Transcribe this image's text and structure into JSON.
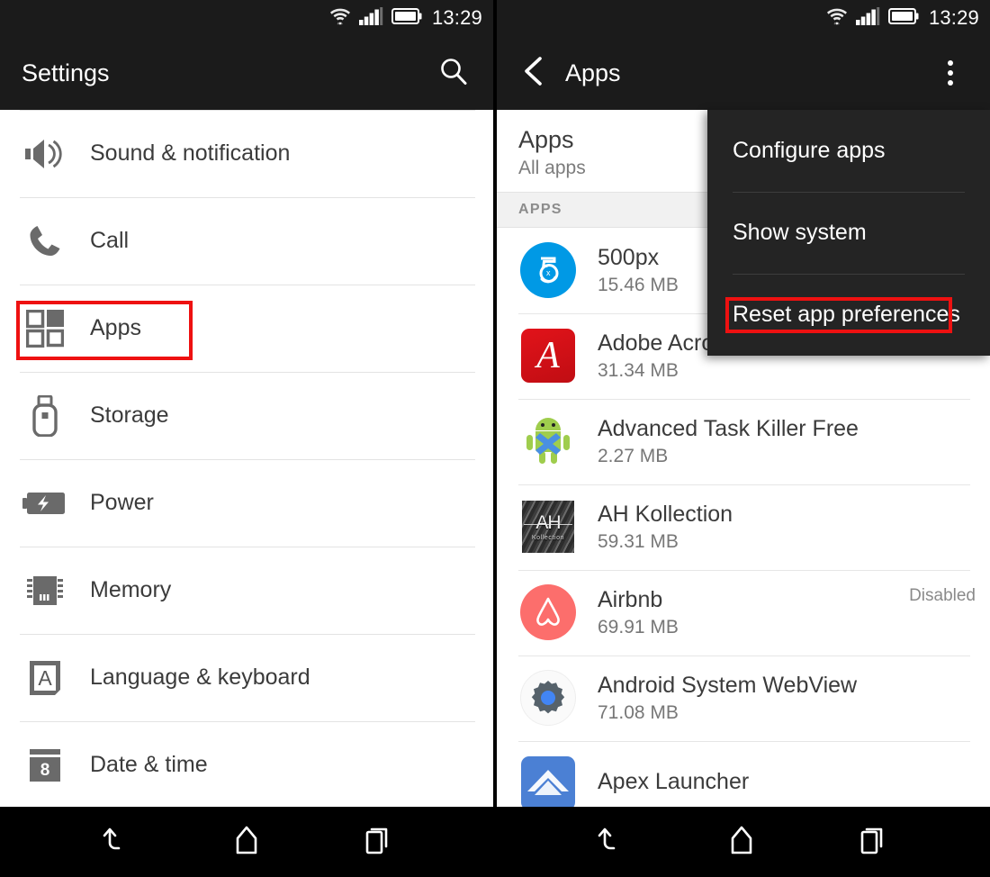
{
  "statusbar": {
    "time": "13:29",
    "icons": [
      "wifi-icon",
      "signal-icon",
      "battery-icon"
    ]
  },
  "left_screen": {
    "title": "Settings",
    "search_icon": "search-icon",
    "items": [
      {
        "label": "Sound & notification",
        "icon": "speaker-icon"
      },
      {
        "label": "Call",
        "icon": "phone-icon"
      },
      {
        "label": "Apps",
        "icon": "apps-grid-icon",
        "highlighted": true
      },
      {
        "label": "Storage",
        "icon": "usb-drive-icon"
      },
      {
        "label": "Power",
        "icon": "battery-bolt-icon"
      },
      {
        "label": "Memory",
        "icon": "memory-chip-icon"
      },
      {
        "label": "Language & keyboard",
        "icon": "letter-a-icon"
      },
      {
        "label": "Date & time",
        "icon": "calendar-icon"
      }
    ]
  },
  "right_screen": {
    "back_icon": "chevron-left-icon",
    "title": "Apps",
    "overflow_icon": "overflow-menu-icon",
    "header": {
      "title": "Apps",
      "subtitle": "All apps"
    },
    "section_label": "APPS",
    "apps": [
      {
        "name": "500px",
        "size": "15.46 MB",
        "status": "",
        "icon": "500px-icon"
      },
      {
        "name": "Adobe Acrobat",
        "size": "31.34 MB",
        "status": "",
        "icon": "adobe-acrobat-icon"
      },
      {
        "name": "Advanced Task Killer Free",
        "size": "2.27 MB",
        "status": "",
        "icon": "android-robot-icon"
      },
      {
        "name": "AH Kollection",
        "size": "59.31 MB",
        "status": "",
        "icon": "ah-kollection-icon"
      },
      {
        "name": "Airbnb",
        "size": "69.91 MB",
        "status": "Disabled",
        "icon": "airbnb-icon"
      },
      {
        "name": "Android System WebView",
        "size": "71.08 MB",
        "status": "",
        "icon": "gear-icon"
      },
      {
        "name": "Apex Launcher",
        "size": "",
        "status": "",
        "icon": "apex-launcher-icon"
      }
    ],
    "menu": {
      "items": [
        {
          "label": "Configure apps",
          "highlighted": false
        },
        {
          "label": "Show system",
          "highlighted": false
        },
        {
          "label": "Reset app preferences",
          "highlighted": true
        }
      ]
    }
  },
  "navbar": {
    "buttons": [
      {
        "icon": "back-icon"
      },
      {
        "icon": "home-icon"
      },
      {
        "icon": "recents-icon"
      }
    ]
  },
  "colors": {
    "highlight": "#ee1111",
    "bar_background": "#1b1b1b",
    "menu_background": "#242424",
    "accent_blue": "#0099e5"
  }
}
